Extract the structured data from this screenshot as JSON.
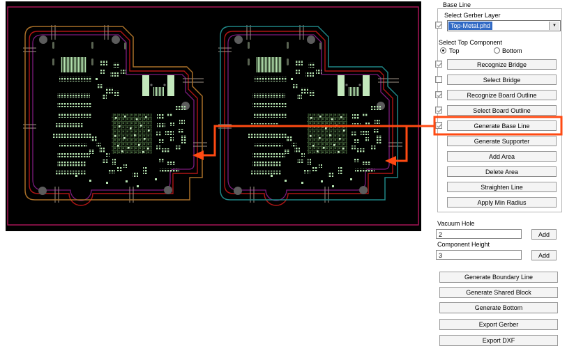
{
  "viewer": {
    "background": "#000000",
    "frame_color": "#a81457",
    "boards": [
      {
        "id": "left",
        "outer_outline_color": "#a86f28"
      },
      {
        "id": "right",
        "outer_outline_color": "#1f8585"
      }
    ],
    "outline_red": "#b01515",
    "outline_purple": "#7d1b7d",
    "pad_color": "#b5e3b0",
    "hole_color": "#5c5c5c"
  },
  "annotation": {
    "color": "#ff4a12",
    "highlighted_button": "Generate Base Line"
  },
  "panel": {
    "group_title": "Base Line",
    "select_gerber_layer_label": "Select Gerber Layer",
    "gerber_layer_value": "Top-Metal.phd",
    "select_top_component_label": "Select Top Component",
    "radio_top_label": "Top",
    "radio_bottom_label": "Bottom",
    "action_rows": [
      {
        "label": "Recognize Bridge",
        "checkbox": true,
        "checked": true
      },
      {
        "label": "Select Bridge",
        "checkbox": true,
        "checked": false
      },
      {
        "label": "Recognize Board Outline",
        "checkbox": true,
        "checked": true
      },
      {
        "label": "Select Board Outline",
        "checkbox": true,
        "checked": true
      },
      {
        "label": "Generate Base Line",
        "checkbox": true,
        "checked": true,
        "highlighted": true
      },
      {
        "label": "Generate Supporter",
        "checkbox": false
      },
      {
        "label": "Add Area",
        "checkbox": false
      },
      {
        "label": "Delete Area",
        "checkbox": false
      },
      {
        "label": "Straighten Line",
        "checkbox": false
      },
      {
        "label": "Apply Min Radius",
        "checkbox": false
      }
    ],
    "vacuum_hole": {
      "label": "Vacuum Hole",
      "value": "2",
      "add_label": "Add"
    },
    "component_height": {
      "label": "Component Height",
      "value": "3",
      "add_label": "Add"
    },
    "bottom_buttons": [
      "Generate Boundary Line",
      "Generate Shared Block",
      "Generate Bottom",
      "Export Gerber",
      "Export DXF"
    ]
  }
}
